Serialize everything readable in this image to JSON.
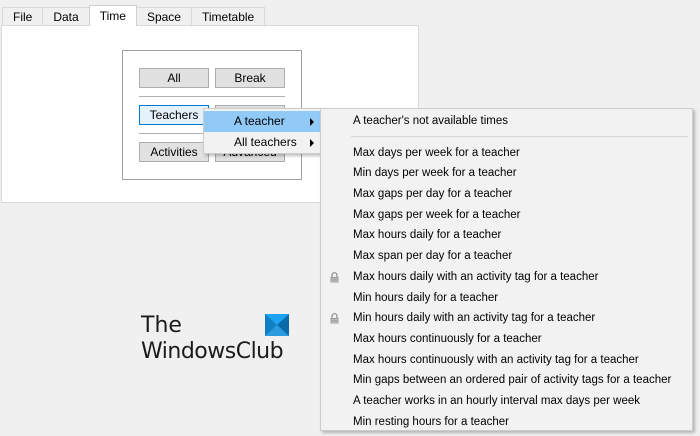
{
  "tabs": [
    "File",
    "Data",
    "Time",
    "Space",
    "Timetable"
  ],
  "active_tab": "Time",
  "panel": {
    "buttons": {
      "all": "All",
      "break": "Break",
      "teachers": "Teachers",
      "activities": "Activities",
      "advanced": "Advanced"
    }
  },
  "submenu": {
    "items": [
      {
        "label": "A teacher",
        "has_submenu": true,
        "highlighted": true
      },
      {
        "label": "All teachers",
        "has_submenu": true,
        "highlighted": false
      }
    ]
  },
  "teacher_menu": {
    "header": "A teacher's not available times",
    "items": [
      {
        "label": "Max days per week for a teacher",
        "icon": ""
      },
      {
        "label": "Min days per week for a teacher",
        "icon": ""
      },
      {
        "label": "Max gaps per day for a teacher",
        "icon": ""
      },
      {
        "label": "Max gaps per week for a teacher",
        "icon": ""
      },
      {
        "label": "Max hours daily for a teacher",
        "icon": ""
      },
      {
        "label": "Max span per day for a teacher",
        "icon": ""
      },
      {
        "label": "Max hours daily with an activity tag for a teacher",
        "icon": "lock-icon"
      },
      {
        "label": "Min hours daily for a teacher",
        "icon": ""
      },
      {
        "label": "Min hours daily with an activity tag for a teacher",
        "icon": "lock-icon"
      },
      {
        "label": "Max hours continuously for a teacher",
        "icon": ""
      },
      {
        "label": "Max hours continuously with an activity tag for a teacher",
        "icon": ""
      },
      {
        "label": "Min gaps between an ordered pair of activity tags for a teacher",
        "icon": ""
      },
      {
        "label": "A teacher works in an hourly interval max days per week",
        "icon": ""
      },
      {
        "label": "Min resting hours for a teacher",
        "icon": ""
      }
    ]
  },
  "watermark": {
    "line1": "The",
    "line2": "WindowsClub"
  },
  "colors": {
    "menu_highlight": "#91c9f7",
    "logo_blue": "#1da1f2"
  }
}
